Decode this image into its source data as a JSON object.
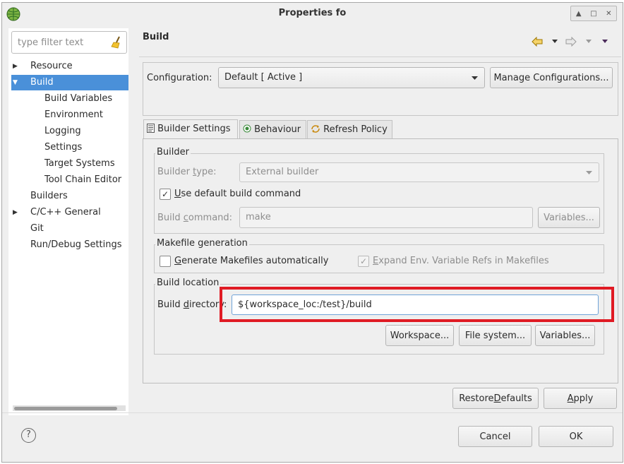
{
  "window": {
    "title": "Properties fo",
    "controls": [
      "▲",
      "□",
      "✕"
    ]
  },
  "sidebar": {
    "filter_placeholder": "type filter text",
    "items": [
      {
        "label": "Resource",
        "toggle": "▶"
      },
      {
        "label": "Build",
        "toggle": "▼"
      },
      {
        "label": "Build Variables"
      },
      {
        "label": "Environment"
      },
      {
        "label": "Logging"
      },
      {
        "label": "Settings"
      },
      {
        "label": "Target Systems"
      },
      {
        "label": "Tool Chain Editor"
      },
      {
        "label": "Builders"
      },
      {
        "label": "C/C++ General",
        "toggle": "▶"
      },
      {
        "label": "Git"
      },
      {
        "label": "Run/Debug Settings"
      }
    ]
  },
  "page": {
    "title": "Build",
    "configuration_label": "Configuration:",
    "configuration_value": "Default  [ Active ]",
    "manage_button": "Manage Configurations...",
    "tabs": [
      "Builder Settings",
      "Behaviour",
      "Refresh Policy"
    ],
    "builder": {
      "group_label": "Builder",
      "type_label_pre": "Builder ",
      "type_label_mn": "t",
      "type_label_post": "ype:",
      "type_value": "External builder",
      "use_default_mn": "U",
      "use_default_post": "se default build command",
      "command_label_pre": "Build ",
      "command_label_mn": "c",
      "command_label_post": "ommand:",
      "command_value": "make",
      "variables_button": "Variables..."
    },
    "makefile": {
      "group_label": "Makefile generation",
      "generate_mn": "G",
      "generate_post": "enerate Makefiles automatically",
      "expand_mn": "E",
      "expand_post": "xpand Env. Variable Refs in Makefiles"
    },
    "location": {
      "group_label": "Build location",
      "dir_label_pre": "Build ",
      "dir_label_mn": "d",
      "dir_label_post": "irectory:",
      "dir_value": "${workspace_loc:/test}/build",
      "workspace_button": "Workspace...",
      "filesystem_button": "File system...",
      "variables_button": "Variables..."
    },
    "restore_pre": "Restore ",
    "restore_mn": "D",
    "restore_post": "efaults",
    "apply_mn": "A",
    "apply_post": "pply"
  },
  "footer": {
    "help": "?",
    "cancel": "Cancel",
    "ok": "OK"
  },
  "colors": {
    "selection": "#4a90d9",
    "highlight_box": "#e01b24"
  }
}
